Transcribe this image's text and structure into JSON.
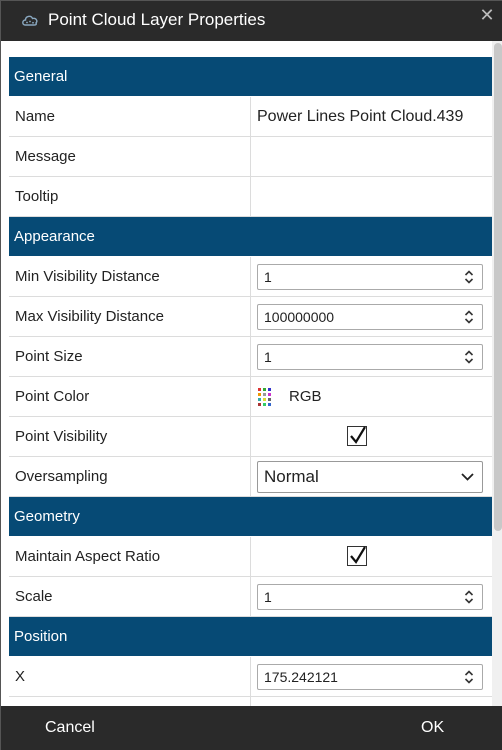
{
  "window": {
    "title": "Point Cloud Layer Properties",
    "close_glyph": "✕"
  },
  "sections": {
    "general": "General",
    "appearance": "Appearance",
    "geometry": "Geometry",
    "position": "Position"
  },
  "general": {
    "name_label": "Name",
    "name_value": "Power Lines Point Cloud.439",
    "message_label": "Message",
    "message_value": "",
    "tooltip_label": "Tooltip",
    "tooltip_value": ""
  },
  "appearance": {
    "min_vis_label": "Min Visibility Distance",
    "min_vis_value": "1",
    "max_vis_label": "Max Visibility Distance",
    "max_vis_value": "100000000",
    "point_size_label": "Point Size",
    "point_size_value": "1",
    "point_color_label": "Point Color",
    "point_color_value": "RGB",
    "point_visibility_label": "Point Visibility",
    "point_visibility_checked": true,
    "oversampling_label": "Oversampling",
    "oversampling_value": "Normal"
  },
  "geometry": {
    "aspect_label": "Maintain Aspect Ratio",
    "aspect_checked": true,
    "scale_label": "Scale",
    "scale_value": "1"
  },
  "position": {
    "x_label": "X",
    "x_value": "175.242121"
  },
  "footer": {
    "cancel_label": "Cancel",
    "ok_label": "OK"
  },
  "colors": {
    "section_bg": "#064a75",
    "titlebar_bg": "#2a2a2a"
  },
  "icons": {
    "title_icon": "point-cloud-icon",
    "close_icon": "close-icon",
    "color_icon": "rgb-color-icon",
    "spinner_icon": "spinner-arrows-icon",
    "dropdown_icon": "chevron-down-icon",
    "check_icon": "checkmark-icon"
  }
}
